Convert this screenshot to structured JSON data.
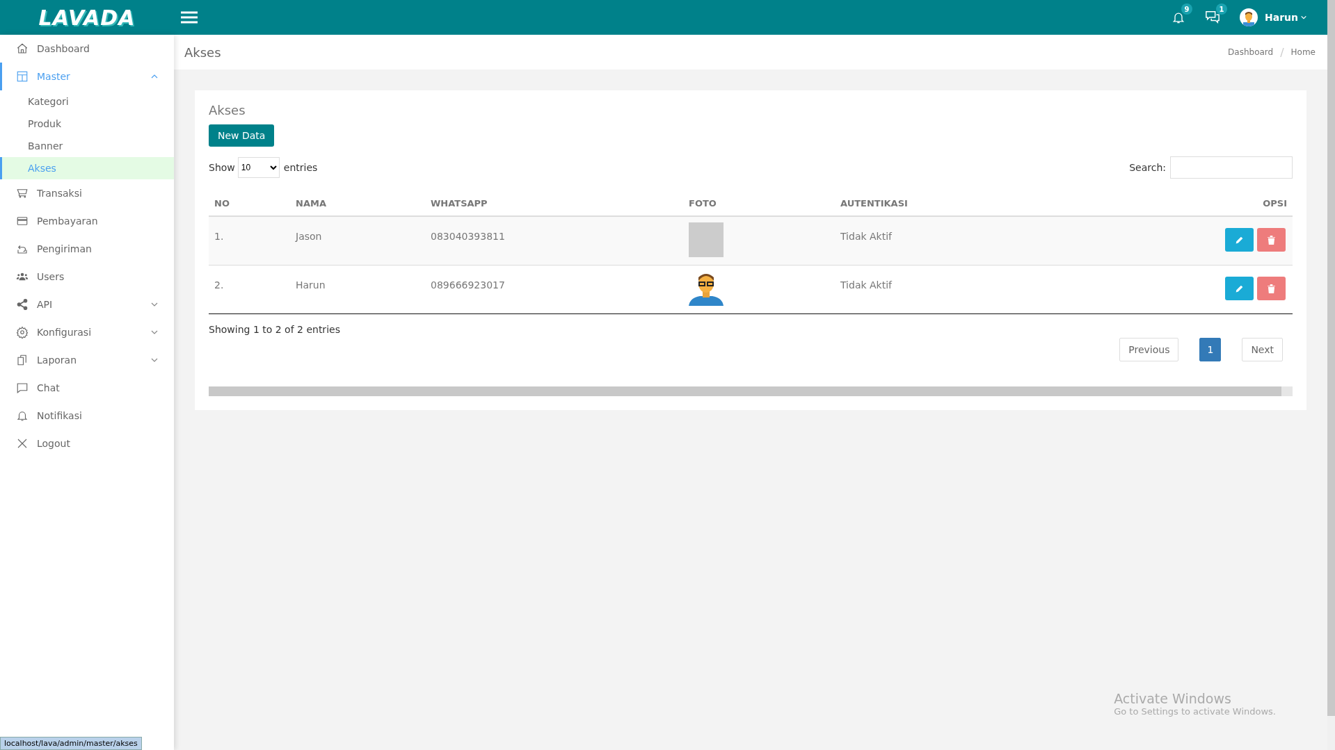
{
  "topbar": {
    "logo": "LAVADA",
    "notification_count": "9",
    "message_count": "1",
    "user_name": "Harun"
  },
  "sidebar": {
    "items": [
      {
        "label": "Dashboard",
        "selected": false
      },
      {
        "label": "Master",
        "selected": true,
        "expanded": true,
        "children": [
          {
            "label": "Kategori",
            "selected": false
          },
          {
            "label": "Produk",
            "selected": false
          },
          {
            "label": "Banner",
            "selected": false
          },
          {
            "label": "Akses",
            "selected": true
          }
        ]
      },
      {
        "label": "Transaksi",
        "selected": false
      },
      {
        "label": "Pembayaran",
        "selected": false
      },
      {
        "label": "Pengiriman",
        "selected": false
      },
      {
        "label": "Users",
        "selected": false
      },
      {
        "label": "API",
        "selected": false,
        "expanded": false
      },
      {
        "label": "Konfigurasi",
        "selected": false,
        "expanded": false
      },
      {
        "label": "Laporan",
        "selected": false,
        "expanded": false
      },
      {
        "label": "Chat",
        "selected": false
      },
      {
        "label": "Notifikasi",
        "selected": false
      },
      {
        "label": "Logout",
        "selected": false
      }
    ]
  },
  "page_header": {
    "title": "Akses",
    "breadcrumbs": [
      "Dashboard",
      "Home"
    ],
    "separator": "/"
  },
  "card": {
    "title": "Akses",
    "new_button": "New Data",
    "show_label": "Show",
    "page_size": "10",
    "entries_label": "entries",
    "search_label": "Search:",
    "table": {
      "columns": [
        "NO",
        "NAMA",
        "WHATSAPP",
        "FOTO",
        "AUTENTIKASI",
        "OPSI"
      ],
      "rows": [
        {
          "no": "1.",
          "nama": "Jason",
          "whatsapp": "083040393811",
          "foto": {
            "kind": "photo"
          },
          "autentikasi": "Tidak Aktif"
        },
        {
          "no": "2.",
          "nama": "Harun",
          "whatsapp": "089666923017",
          "foto": {
            "kind": "illustration"
          },
          "autentikasi": "Tidak Aktif"
        }
      ]
    },
    "info": "Showing 1 to 2 of 2 entries",
    "pagination": [
      {
        "label": "Previous",
        "kind": "nav",
        "selected": false
      },
      {
        "label": "1",
        "kind": "page",
        "selected": true
      },
      {
        "label": "Next",
        "kind": "nav",
        "selected": false
      }
    ]
  },
  "status_url": "localhost/lava/admin/master/akses",
  "os_notice": {
    "title": "Activate Windows",
    "text": "Go to Settings to activate Windows."
  }
}
